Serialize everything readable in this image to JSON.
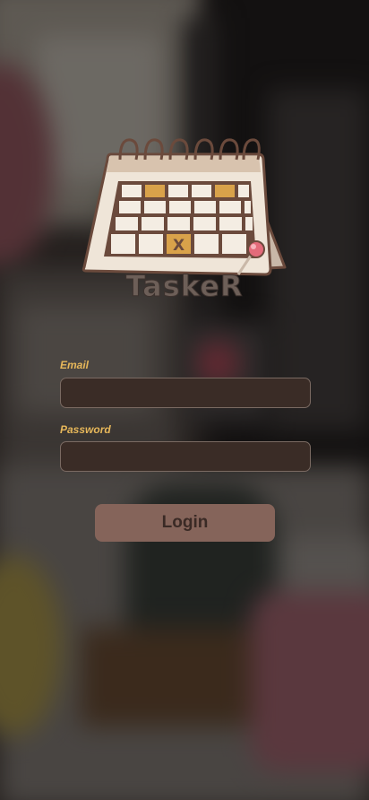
{
  "app": {
    "name": "TaskeR"
  },
  "logo": {
    "icon": "calendar-icon",
    "mark": "X"
  },
  "form": {
    "email_label": "Email",
    "email_value": "",
    "email_placeholder": "",
    "password_label": "Password",
    "password_value": "",
    "password_placeholder": "",
    "login_label": "Login"
  },
  "colors": {
    "label": "#e6b75a",
    "field_bg": "#3a2c26",
    "button_bg": "#85645a",
    "button_text": "#3a2a25",
    "logo_text": "#6d5f58"
  }
}
